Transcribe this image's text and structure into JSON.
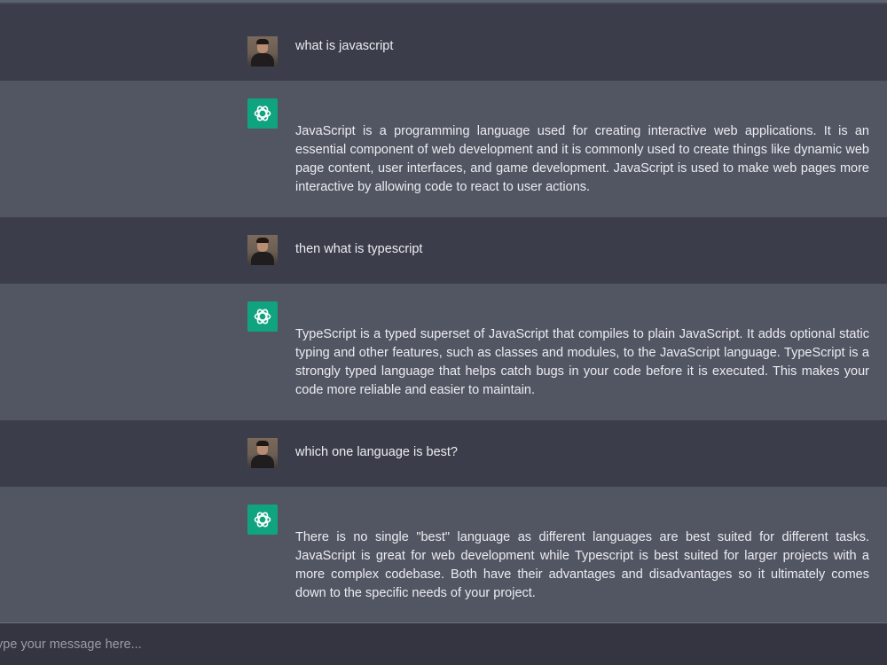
{
  "conversation": [
    {
      "role": "user",
      "avatar_icon": "user-photo-avatar",
      "text": "what is javascript"
    },
    {
      "role": "assistant",
      "avatar_icon": "openai-logo-icon",
      "text": "JavaScript is a programming language used for creating interactive web applications. It is an essential component of web development and it is commonly used to create things like dynamic web page content, user interfaces, and game development. JavaScript is used to make web pages more interactive by allowing code to react to user actions."
    },
    {
      "role": "user",
      "avatar_icon": "user-photo-avatar",
      "text": "then what is typescript"
    },
    {
      "role": "assistant",
      "avatar_icon": "openai-logo-icon",
      "text": "TypeScript is a typed superset of JavaScript that compiles to plain JavaScript. It adds optional static typing and other features, such as classes and modules, to the JavaScript language. TypeScript is a strongly typed language that helps catch bugs in your code before it is executed. This makes your code more reliable and easier to maintain."
    },
    {
      "role": "user",
      "avatar_icon": "user-photo-avatar",
      "text": "which one language is best?"
    },
    {
      "role": "assistant",
      "avatar_icon": "openai-logo-icon",
      "text": "There is no single \"best\" language as different languages are best suited for different tasks. JavaScript is great for web development while Typescript is best suited for larger projects with a more complex codebase. Both have their advantages and disadvantages so it ultimately comes down to the specific needs of your project."
    }
  ],
  "composer": {
    "placeholder": "Type your message here...",
    "value": ""
  },
  "colors": {
    "user_row_bg": "#3b3e4a",
    "assistant_row_bg": "#525663",
    "assistant_avatar_bg": "#10a37f",
    "composer_bg": "#343541",
    "text": "#ececf1"
  }
}
